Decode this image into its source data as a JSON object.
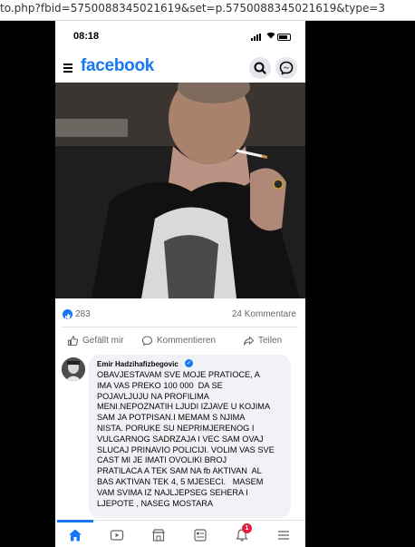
{
  "browser": {
    "url_text": "to.php?fbid=5750088345021619&set=p.5750088345021619&type=3"
  },
  "status_bar": {
    "time": "08:18"
  },
  "header": {
    "logo": "facebook",
    "search_icon": "search-icon",
    "messenger_icon": "messenger-icon",
    "menu_icon": "menu-icon"
  },
  "post": {
    "photo_description_icon": "photo",
    "like_count": "283",
    "comments_count": "24 Kommentare",
    "actions": {
      "like": "Gefällt mir",
      "comment": "Kommentieren",
      "share": "Teilen"
    }
  },
  "comment": {
    "author": "Emir Hadzihafizbegovic",
    "text": "OBAVJESTAVAM SVE MOJE PRATIOCE, A\nIMA VAS PREKO 100 000  DA SE\nPOJAVLJUJU NA PROFILIMA\nMENI.NEPOZNATIH LJUDI IZJAVE U KOJIMA\nSAM JA POTPISAN.I MEMAM S NJIMA\nNISTA. PORUKE SU NEPRIMJERENOG I\nVULGARNOG SADRZAJA I VEC SAM OVAJ\nSLUCAJ PRINAVIO POLICIJI. VOLIM VAS SVE\nCAST MI JE IMATI OVOLIKI BROJ\nPRATILACA A TEK SAM NA fb AKTIVAN  AL\nBAS AKTIVAN TEK 4, 5 MJESECI.   MASEM\nVAM SVIMA IZ NAJLJEPSEG SEHERA I\nLJEPOTE , NASEG MOSTARA"
  },
  "bottom_nav": {
    "notifications_badge": "1",
    "items": [
      "home-icon",
      "video-icon",
      "marketplace-icon",
      "feeds-icon",
      "bell-icon",
      "hamburger-icon"
    ]
  },
  "colors": {
    "brand": "#1877f2",
    "badge": "#e41e3f",
    "text_secondary": "#65676b",
    "bubble": "#f0f2f5"
  }
}
